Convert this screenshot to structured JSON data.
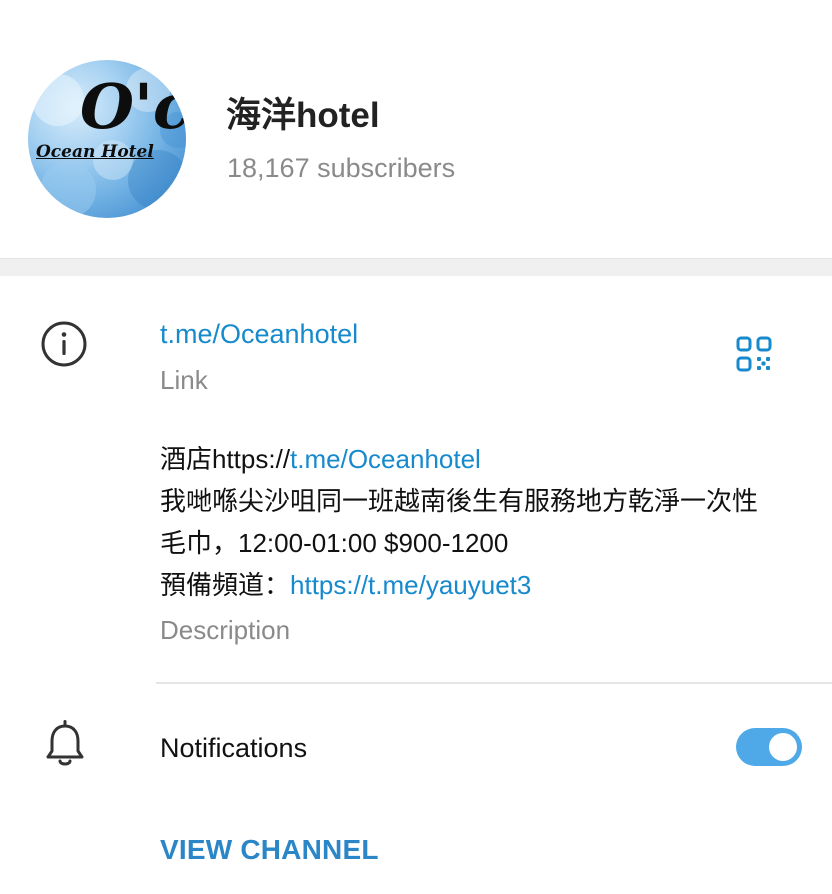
{
  "channel": {
    "name": "海洋hotel",
    "subscribers": "18,167 subscribers",
    "avatar": {
      "big_text": "O'c",
      "sub_text": "Ocean Hotel"
    }
  },
  "info": {
    "link": "t.me/Oceanhotel",
    "link_label": "Link",
    "description": {
      "line1_prefix": "酒店https://",
      "line1_link": "t.me/Oceanhotel",
      "line2": "我哋喺尖沙咀同一班越南後生有服務地方乾淨一次性",
      "line3": "毛巾，12:00-01:00 $900-1200",
      "line4_prefix": "預備頻道：",
      "line4_link": "https://t.me/yauyuet3"
    },
    "description_label": "Description"
  },
  "notifications": {
    "label": "Notifications",
    "enabled": true
  },
  "actions": {
    "view_channel": "VIEW CHANNEL"
  },
  "colors": {
    "link": "#168acd",
    "accent": "#4fa9e8",
    "muted": "#8a8a8a"
  },
  "icons": [
    "info-icon",
    "qr-code-icon",
    "bell-icon"
  ]
}
